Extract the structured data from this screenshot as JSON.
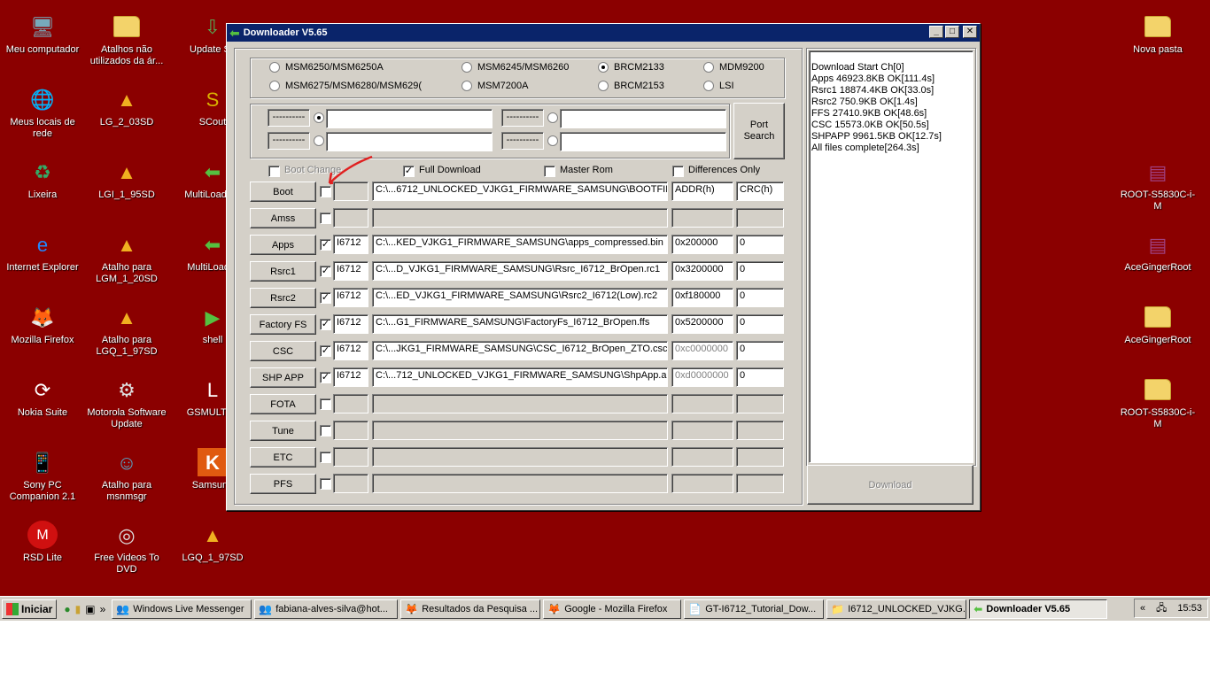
{
  "desktop": {
    "icons": [
      {
        "label": "Meu computador",
        "icon": "computer-icon"
      },
      {
        "label": "Meus locais de rede",
        "icon": "network-icon"
      },
      {
        "label": "Lixeira",
        "icon": "recycle-bin-icon"
      },
      {
        "label": "Internet Explorer",
        "icon": "internet-explorer-icon"
      },
      {
        "label": "Mozilla Firefox",
        "icon": "firefox-icon"
      },
      {
        "label": "Nokia Suite",
        "icon": "nokia-suite-icon"
      },
      {
        "label": "Sony PC Companion 2.1",
        "icon": "sony-pc-companion-icon"
      },
      {
        "label": "RSD Lite",
        "icon": "motorola-icon"
      },
      {
        "label": "Atalhos não utilizados da ár...",
        "icon": "folder-icon"
      },
      {
        "label": "LG_2_03SD",
        "icon": "app-shortcut-icon"
      },
      {
        "label": "LGI_1_95SD",
        "icon": "app-shortcut-icon"
      },
      {
        "label": "Atalho para LGM_1_20SD",
        "icon": "app-shortcut-icon"
      },
      {
        "label": "Atalho para LGQ_1_97SD",
        "icon": "app-shortcut-icon"
      },
      {
        "label": "Motorola Software Update",
        "icon": "motorola-software-icon"
      },
      {
        "label": "Atalho para msnmsgr",
        "icon": "msn-icon"
      },
      {
        "label": "Free Videos To DVD",
        "icon": "dvd-icon"
      },
      {
        "label": "Update Se",
        "icon": "update-icon"
      },
      {
        "label": "SCout",
        "icon": "scout-icon"
      },
      {
        "label": "MultiLoader_",
        "icon": "multiloader-icon"
      },
      {
        "label": "MultiLoader",
        "icon": "multiloader-icon"
      },
      {
        "label": "shell",
        "icon": "shell-icon"
      },
      {
        "label": "GSMULTI V",
        "icon": "gsmulti-icon"
      },
      {
        "label": "Samsung",
        "icon": "samsung-kies-icon"
      },
      {
        "label": "LGQ_1_97SD",
        "icon": "app-shortcut-icon"
      },
      {
        "label": "Nova pasta",
        "icon": "folder-icon"
      },
      {
        "label": "ROOT-S5830C-i-M",
        "icon": "winrar-archive-icon"
      },
      {
        "label": "AceGingerRoot",
        "icon": "winrar-archive-icon"
      },
      {
        "label": "AceGingerRoot",
        "icon": "folder-icon"
      },
      {
        "label": "ROOT-S5830C-i-M",
        "icon": "folder-icon"
      }
    ]
  },
  "window": {
    "title": "Downloader V5.65",
    "minimize": "_",
    "maximize": "□",
    "close": "✕",
    "chipsets": [
      {
        "label": "MSM6250/MSM6250A",
        "selected": false
      },
      {
        "label": "MSM6245/MSM6260",
        "selected": false
      },
      {
        "label": "BRCM2133",
        "selected": true
      },
      {
        "label": "MDM9200",
        "selected": false
      },
      {
        "label": "MSM6275/MSM6280/MSM629(",
        "selected": false
      },
      {
        "label": "MSM7200A",
        "selected": false
      },
      {
        "label": "BRCM2153",
        "selected": false
      },
      {
        "label": "LSI",
        "selected": false
      }
    ],
    "ports": [
      "----------",
      "----------",
      "----------",
      "----------"
    ],
    "port_search": "Port Search",
    "options": {
      "boot_change": "Boot Change",
      "full_download": "Full Download",
      "master_rom": "Master Rom",
      "differences_only": "Differences Only"
    },
    "rows": [
      {
        "name": "Boot",
        "checked": false,
        "model": "",
        "path": "C:\\...6712_UNLOCKED_VJKG1_FIRMWARE_SAMSUNG\\BOOTFIL",
        "addr": "ADDR(h)",
        "crc": "CRC(h)"
      },
      {
        "name": "Amss",
        "checked": false,
        "model": "",
        "path": "",
        "addr": "",
        "crc": ""
      },
      {
        "name": "Apps",
        "checked": true,
        "model": "I6712",
        "path": "C:\\...KED_VJKG1_FIRMWARE_SAMSUNG\\apps_compressed.bin",
        "addr": "0x200000",
        "crc": "0"
      },
      {
        "name": "Rsrc1",
        "checked": true,
        "model": "I6712",
        "path": "C:\\...D_VJKG1_FIRMWARE_SAMSUNG\\Rsrc_I6712_BrOpen.rc1",
        "addr": "0x3200000",
        "crc": "0"
      },
      {
        "name": "Rsrc2",
        "checked": true,
        "model": "I6712",
        "path": "C:\\...ED_VJKG1_FIRMWARE_SAMSUNG\\Rsrc2_I6712(Low).rc2",
        "addr": "0xf180000",
        "crc": "0"
      },
      {
        "name": "Factory FS",
        "checked": true,
        "model": "I6712",
        "path": "C:\\...G1_FIRMWARE_SAMSUNG\\FactoryFs_I6712_BrOpen.ffs",
        "addr": "0x5200000",
        "crc": "0"
      },
      {
        "name": "CSC",
        "checked": true,
        "model": "I6712",
        "path": "C:\\...JKG1_FIRMWARE_SAMSUNG\\CSC_I6712_BrOpen_ZTO.csc",
        "addr": "0xc0000000",
        "crc": "0",
        "addr_grayed": true
      },
      {
        "name": "SHP APP",
        "checked": true,
        "model": "I6712",
        "path": "C:\\...712_UNLOCKED_VJKG1_FIRMWARE_SAMSUNG\\ShpApp.a",
        "addr": "0xd0000000",
        "crc": "0",
        "addr_grayed": true
      },
      {
        "name": "FOTA",
        "checked": false,
        "model": "",
        "path": "",
        "addr": "",
        "crc": ""
      },
      {
        "name": "Tune",
        "checked": false,
        "model": "",
        "path": "",
        "addr": "",
        "crc": ""
      },
      {
        "name": "ETC",
        "checked": false,
        "model": "",
        "path": "",
        "addr": "",
        "crc": ""
      },
      {
        "name": "PFS",
        "checked": false,
        "model": "",
        "path": "",
        "addr": "",
        "crc": ""
      }
    ],
    "log": [
      "Download Start Ch[0]",
      "Apps 46923.8KB OK[111.4s]",
      "Rsrc1 18874.4KB OK[33.0s]",
      "Rsrc2 750.9KB OK[1.4s]",
      "FFS 27410.9KB OK[48.6s]",
      "CSC 15573.0KB OK[50.5s]",
      "SHPAPP 9961.5KB OK[12.7s]",
      "All files complete[264.3s]"
    ],
    "download_button": "Download"
  },
  "taskbar": {
    "start": "Iniciar",
    "quicklaunch": [
      "messenger-icon",
      "folder-icon",
      "network-icon"
    ],
    "expand": "»",
    "tasks": [
      {
        "label": "Windows Live Messenger",
        "icon": "messenger-icon",
        "active": false
      },
      {
        "label": "fabiana-alves-silva@hot...",
        "icon": "messenger-icon",
        "active": false
      },
      {
        "label": "Resultados da Pesquisa ...",
        "icon": "firefox-icon",
        "active": false
      },
      {
        "label": "Google - Mozilla Firefox",
        "icon": "firefox-icon",
        "active": false
      },
      {
        "label": "GT-I6712_Tutorial_Dow...",
        "icon": "pdf-icon",
        "active": false
      },
      {
        "label": "I6712_UNLOCKED_VJKG...",
        "icon": "folder-icon",
        "active": false
      },
      {
        "label": "Downloader V5.65",
        "icon": "downloader-icon",
        "active": true
      }
    ],
    "tray_expand": "«",
    "clock": "15:53"
  },
  "colors": {
    "desktop": "#8b0000",
    "titlebar": "#0a246a",
    "face": "#d4d0c8",
    "arrow": "#e02020"
  }
}
